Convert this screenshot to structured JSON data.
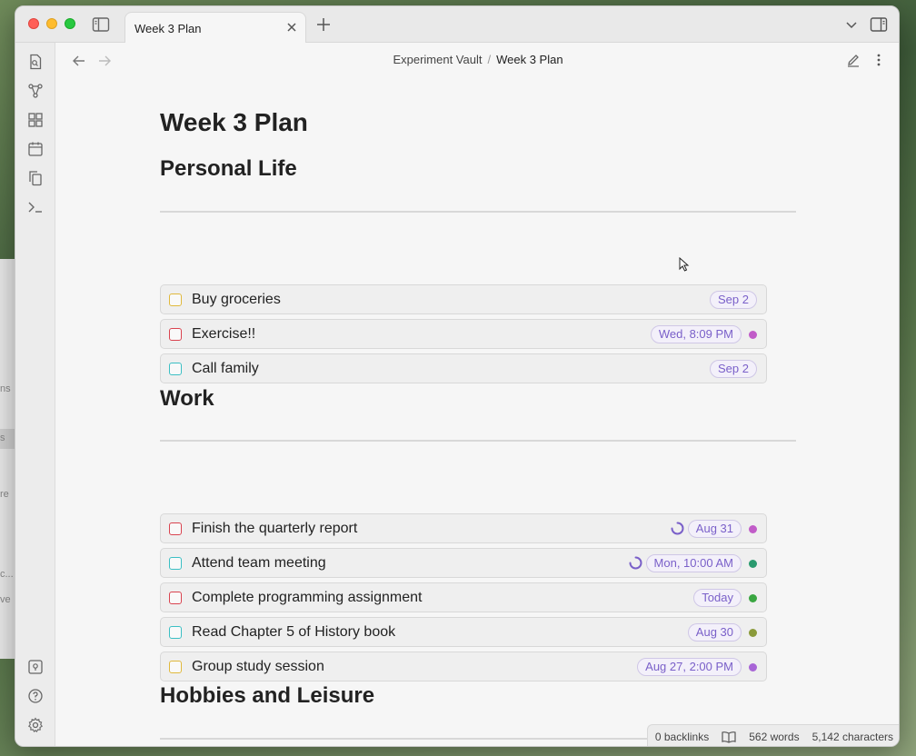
{
  "window": {
    "tab_title": "Week 3 Plan",
    "breadcrumb": {
      "vault": "Experiment Vault",
      "separator": "/",
      "note": "Week 3 Plan"
    }
  },
  "document": {
    "title": "Week 3 Plan",
    "sections": [
      {
        "heading": "Personal Life",
        "tasks": [
          {
            "text": "Buy groceries",
            "checkbox_color": "#e0b93c",
            "date": "Sep 2",
            "dot_color": null,
            "spinner": false
          },
          {
            "text": "Exercise!!",
            "checkbox_color": "#d9434f",
            "date": "Wed, 8:09 PM",
            "dot_color": "#c15cc8",
            "spinner": false
          },
          {
            "text": "Call family",
            "checkbox_color": "#3bbfc4",
            "date": "Sep 2",
            "dot_color": null,
            "spinner": false
          }
        ]
      },
      {
        "heading": "Work",
        "tasks": [
          {
            "text": "Finish the quarterly report",
            "checkbox_color": "#d9434f",
            "date": "Aug 31",
            "dot_color": "#c15cc8",
            "spinner": true
          },
          {
            "text": "Attend team meeting",
            "checkbox_color": "#3bbfc4",
            "date": "Mon, 10:00 AM",
            "dot_color": "#2a9a6e",
            "spinner": true
          },
          {
            "text": "Complete programming assignment",
            "checkbox_color": "#d9434f",
            "date": "Today",
            "dot_color": "#3aa641",
            "spinner": false
          },
          {
            "text": "Read Chapter 5 of History book",
            "checkbox_color": "#3bbfc4",
            "date": "Aug 30",
            "dot_color": "#8a9a3a",
            "spinner": false
          },
          {
            "text": "Group study session",
            "checkbox_color": "#e0b93c",
            "date": "Aug 27, 2:00 PM",
            "dot_color": "#a865d6",
            "spinner": false
          }
        ]
      },
      {
        "heading": "Hobbies and Leisure",
        "tasks": []
      }
    ]
  },
  "status_bar": {
    "backlinks": "0 backlinks",
    "words": "562 words",
    "characters": "5,142 characters"
  },
  "colors": {
    "accent": "#7a60c9"
  },
  "background_fragments": [
    "ns",
    "s",
    "re",
    "c...",
    "ve"
  ]
}
